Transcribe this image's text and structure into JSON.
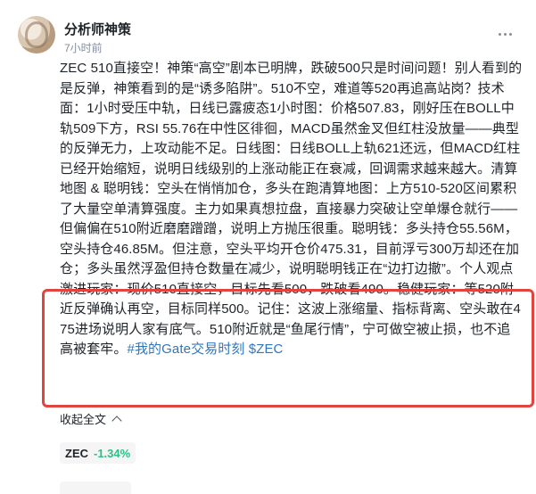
{
  "author": {
    "name": "分析师神策",
    "time": "7小时前"
  },
  "post": {
    "body": "ZEC 510直接空！神策“高空”剧本已明牌，跌破500只是时间问题！别人看到的是反弹，神策看到的是“诱多陷阱”。510不空，难道等520再追高站岗？技术面：1小时受压中轨，日线已露疲态1小时图：价格507.83，刚好压在BOLL中轨509下方，RSI 55.76在中性区徘徊，MACD虽然金叉但红柱没放量——典型的反弹无力，上攻动能不足。日线图：日线BOLL上轨621还远，但MACD红柱已经开始缩短，说明日线级别的上涨动能正在衰减，回调需求越来越大。清算地图 & 聪明钱：空头在悄悄加仓，多头在跑清算地图：上方510-520区间累积了大量空单清算强度。主力如果真想拉盘，直接暴力突破让空单爆仓就行——但偏偏在510附近磨磨蹭蹭，说明上方抛压很重。聪明钱：多头持仓55.56M，空头持仓46.85M。但注意，空头平均开仓价475.31，目前浮亏300万却还在加仓；多头虽然浮盈但持仓数量在减少，说明聪明钱正在“边打边撤”。个人观点激进玩家：现价510直接空，目标先看500，跌破看490。稳健玩家：等520附近反弹确认再空，目标同样500。记住：这波上涨缩量、指标背离、空头敢在475进场说明人家有底气。510附近就是“鱼尾行情”，宁可做空被止损，也不追高被套牢。",
    "tags": "#我的Gate交易时刻 $ZEC"
  },
  "collapse_label": "收起全文",
  "ticker": {
    "symbol": "ZEC",
    "change": "-1.34%"
  },
  "colors": {
    "accent_link": "#3375bb",
    "highlight": "#e2453f",
    "change": "#2ebd85"
  }
}
